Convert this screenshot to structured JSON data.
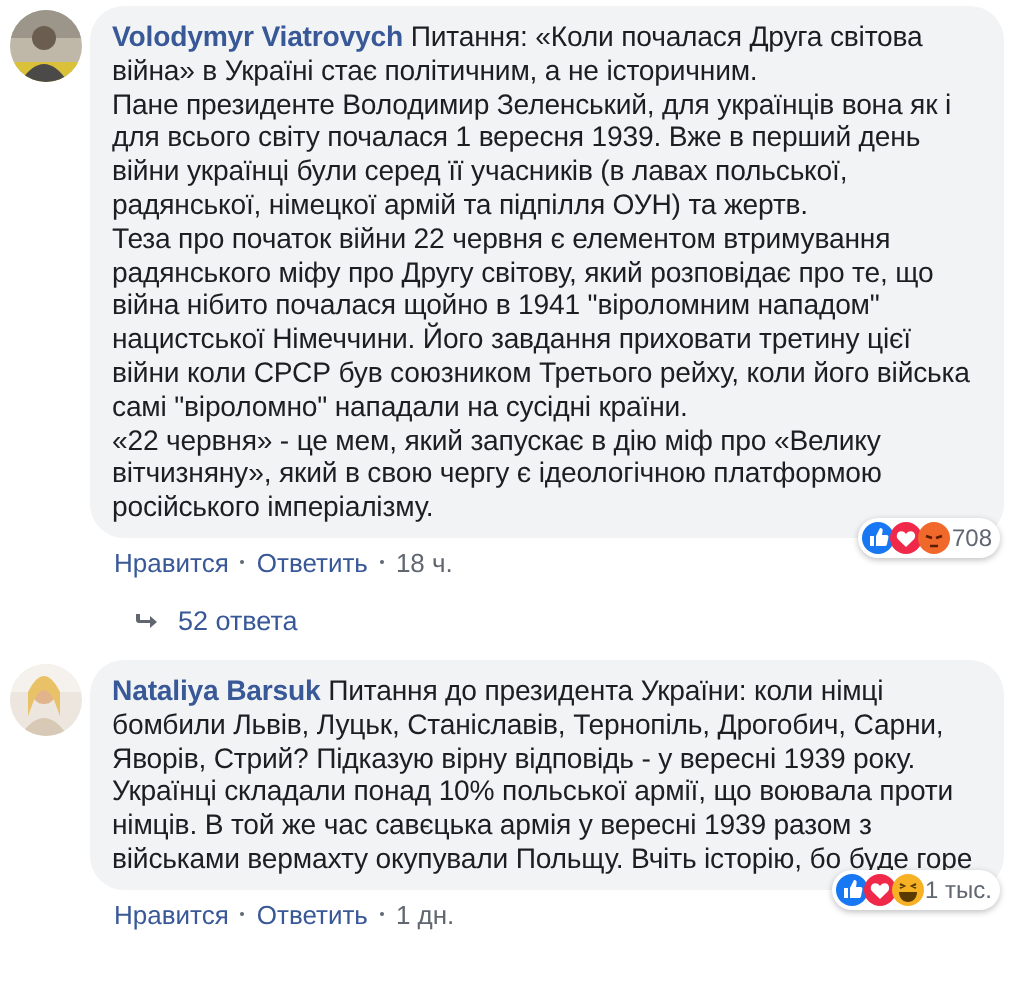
{
  "comments": [
    {
      "author": "Volodymyr Viatrovych",
      "text": "Питання: «Коли почалася Друга світова війна» в Україні стає політичним, а не історичним.\nПане президенте Володимир Зеленський, для українців вона як і для всього світу почалася 1 вересня 1939. Вже в перший день війни українці були серед її учасників (в лавах польської, радянської, німецкої армій та підпілля ОУН) та жертв.\nТеза про початок війни 22 червня є елементом втримування радянського міфу про Другу світову, який розповідає про те, що війна нібито почалася щойно в 1941 \"віроломним нападом\" нацистської Німеччини. Його завдання приховати третину цієї війни коли СРСР був союзником Третього рейху, коли його війська самі \"віроломно\" нападали на сусідні країни.\n«22 червня» - це мем, який запускає в дію міф про «Велику вітчизняну», який в свою чергу є ідеологічною платформою російського імперіалізму.",
      "reactions": [
        {
          "kind": "like"
        },
        {
          "kind": "love"
        },
        {
          "kind": "angry"
        }
      ],
      "reaction_count": "708",
      "actions": [
        "Нравится",
        "Ответить"
      ],
      "time": "18 ч.",
      "replies": "52 ответа",
      "avatar": {
        "kind": "picture"
      }
    },
    {
      "author": "Nataliya Barsuk",
      "text": "Питання до президента України: коли німці бомбили Львів, Луцьк, Станіславів, Тернопіль, Дрогобич, Сарни, Яворів, Стрий? Підказую вірну відповідь - у вересні 1939 року. Українці складали понад 10% польської армії, що воювала проти німців. В той же час савєцька армія у вересні 1939 разом з військами вермахту окупували Польщу. Вчіть історію, бо буде горе",
      "reactions": [
        {
          "kind": "like"
        },
        {
          "kind": "love"
        },
        {
          "kind": "haha"
        }
      ],
      "reaction_count": "1 тыс.",
      "actions": [
        "Нравится",
        "Ответить"
      ],
      "time": "1 дн.",
      "avatar": {
        "kind": "picture"
      }
    }
  ]
}
